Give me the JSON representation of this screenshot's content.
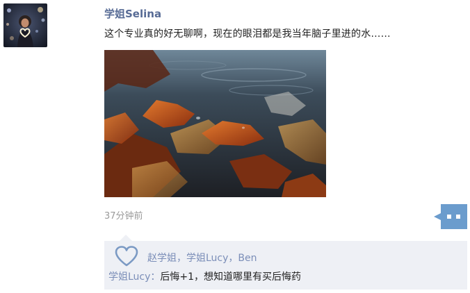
{
  "post": {
    "author": "学姐Selina",
    "text": "这个专业真的好无聊啊，现在的眼泪都是我当年脑子里进的水……",
    "time": "37分钟前"
  },
  "likes": {
    "names": [
      "赵学姐",
      "学姐Lucy",
      "Ben"
    ],
    "separator": "，"
  },
  "comment": {
    "author": "学姐Lucy",
    "colon": "：",
    "text": "后悔+1，想知道哪里有买后悔药"
  },
  "colors": {
    "link": "#576b95",
    "like_name": "#7b8eb8",
    "panel_bg": "#eef0f5",
    "comment_button": "#6b9ccd"
  }
}
